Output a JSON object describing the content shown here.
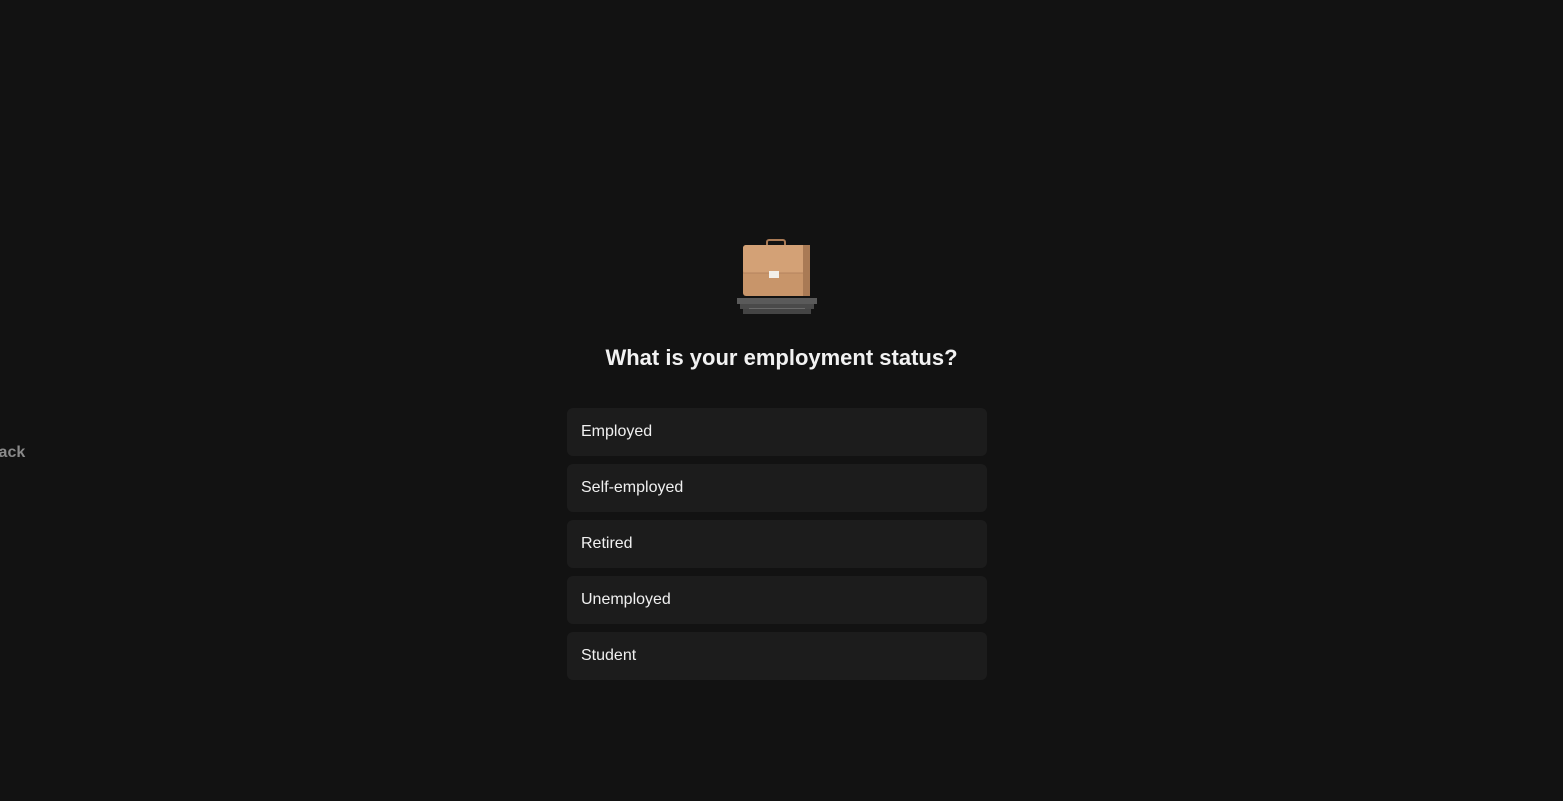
{
  "nav": {
    "back_label": "Back"
  },
  "question": {
    "icon": "briefcase-icon",
    "title": "What is your employment status?",
    "options": [
      {
        "label": "Employed"
      },
      {
        "label": "Self-employed"
      },
      {
        "label": "Retired"
      },
      {
        "label": "Unemployed"
      },
      {
        "label": "Student"
      }
    ]
  },
  "colors": {
    "background": "#121212",
    "option_background": "#1c1c1c",
    "title_text": "#f2f2f2",
    "muted_text": "#8a8a8a",
    "briefcase": "#c89066"
  }
}
